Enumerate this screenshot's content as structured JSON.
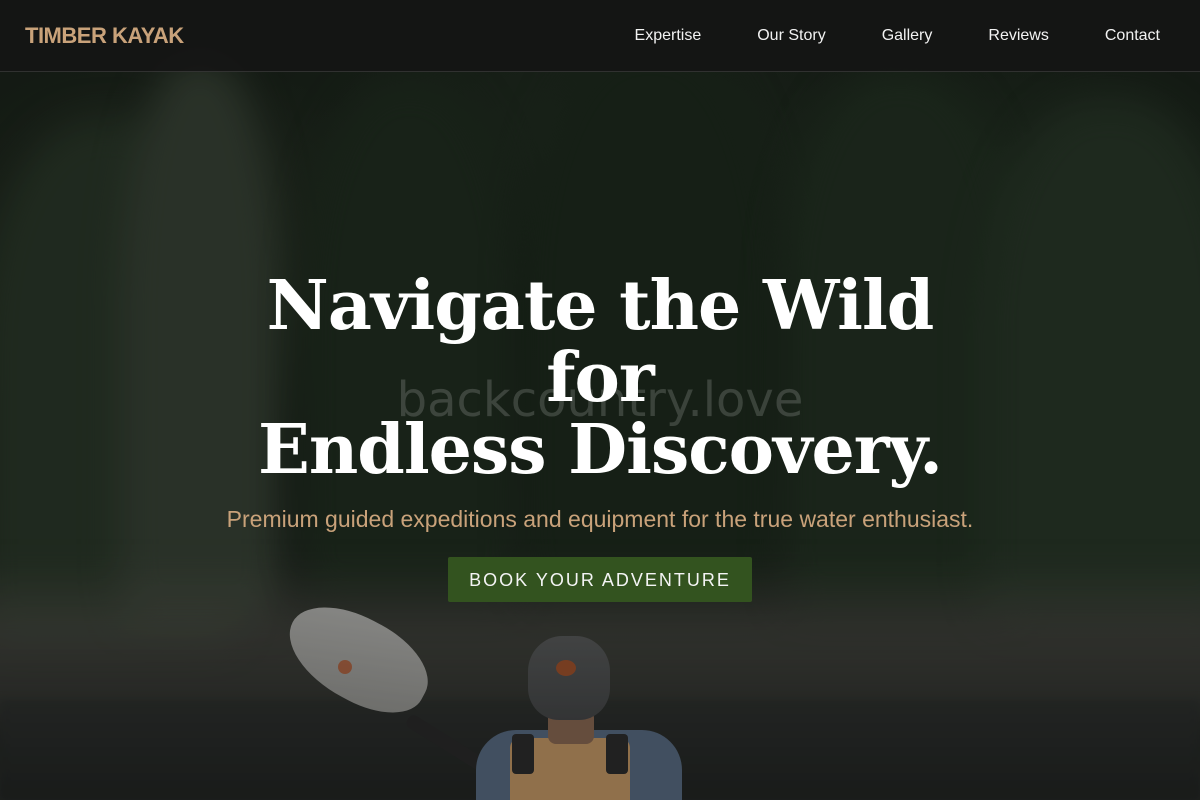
{
  "brand": {
    "name": "TIMBER KAYAK",
    "color": "#c9a27a"
  },
  "nav": {
    "items": [
      {
        "label": "Expertise"
      },
      {
        "label": "Our Story"
      },
      {
        "label": "Gallery"
      },
      {
        "label": "Reviews"
      },
      {
        "label": "Contact"
      }
    ]
  },
  "hero": {
    "title_line1": "Navigate the Wild for",
    "title_line2": "Endless Discovery.",
    "watermark": "backcountry.love",
    "subtitle": "Premium guided expeditions and equipment for the true water enthusiast.",
    "cta_label": "BOOK YOUR ADVENTURE",
    "cta_color": "#33531f",
    "background_image": "kayaker-paddling-forest-lake"
  }
}
